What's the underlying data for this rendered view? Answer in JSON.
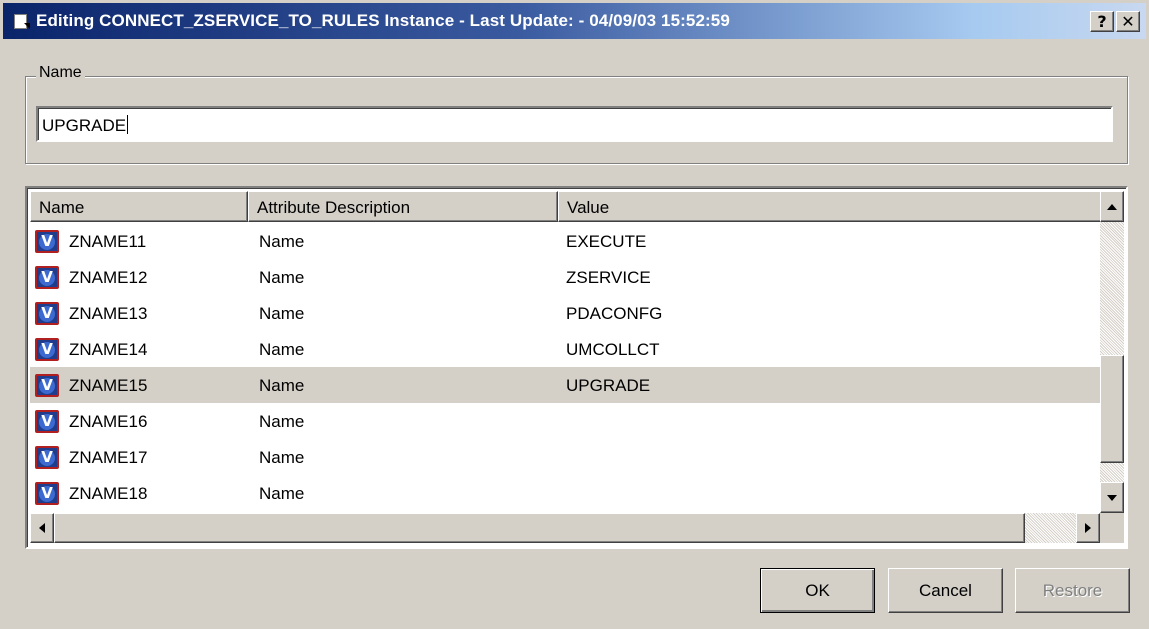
{
  "window": {
    "title": "Editing CONNECT_ZSERVICE_TO_RULES Instance - Last Update: - 04/09/03 15:52:59",
    "help_label": "?",
    "close_label": "✕"
  },
  "name_group": {
    "legend": "Name",
    "value": "UPGRADE"
  },
  "table": {
    "columns": [
      "Name",
      "Attribute Description",
      "Value"
    ],
    "rows": [
      {
        "icon": "V",
        "name": "ZNAME11",
        "desc": "Name",
        "value": "EXECUTE"
      },
      {
        "icon": "V",
        "name": "ZNAME12",
        "desc": "Name",
        "value": "ZSERVICE"
      },
      {
        "icon": "V",
        "name": "ZNAME13",
        "desc": "Name",
        "value": "PDACONFG"
      },
      {
        "icon": "V",
        "name": "ZNAME14",
        "desc": "Name",
        "value": "UMCOLLCT"
      },
      {
        "icon": "V",
        "name": "ZNAME15",
        "desc": "Name",
        "value": "UPGRADE"
      },
      {
        "icon": "V",
        "name": "ZNAME16",
        "desc": "Name",
        "value": ""
      },
      {
        "icon": "V",
        "name": "ZNAME17",
        "desc": "Name",
        "value": ""
      },
      {
        "icon": "V",
        "name": "ZNAME18",
        "desc": "Name",
        "value": ""
      }
    ],
    "selected_row": "ZNAME15"
  },
  "buttons": {
    "ok": "OK",
    "cancel": "Cancel",
    "restore": "Restore"
  },
  "colors": {
    "titlebar_start": "#0a246a",
    "titlebar_end": "#a6caf0",
    "face": "#d4d0c8",
    "icon_bg": "#1f3d8c",
    "icon_border": "#b02020"
  },
  "icons": {
    "app": "document-arrow-icon",
    "row": "variable-v-icon"
  }
}
